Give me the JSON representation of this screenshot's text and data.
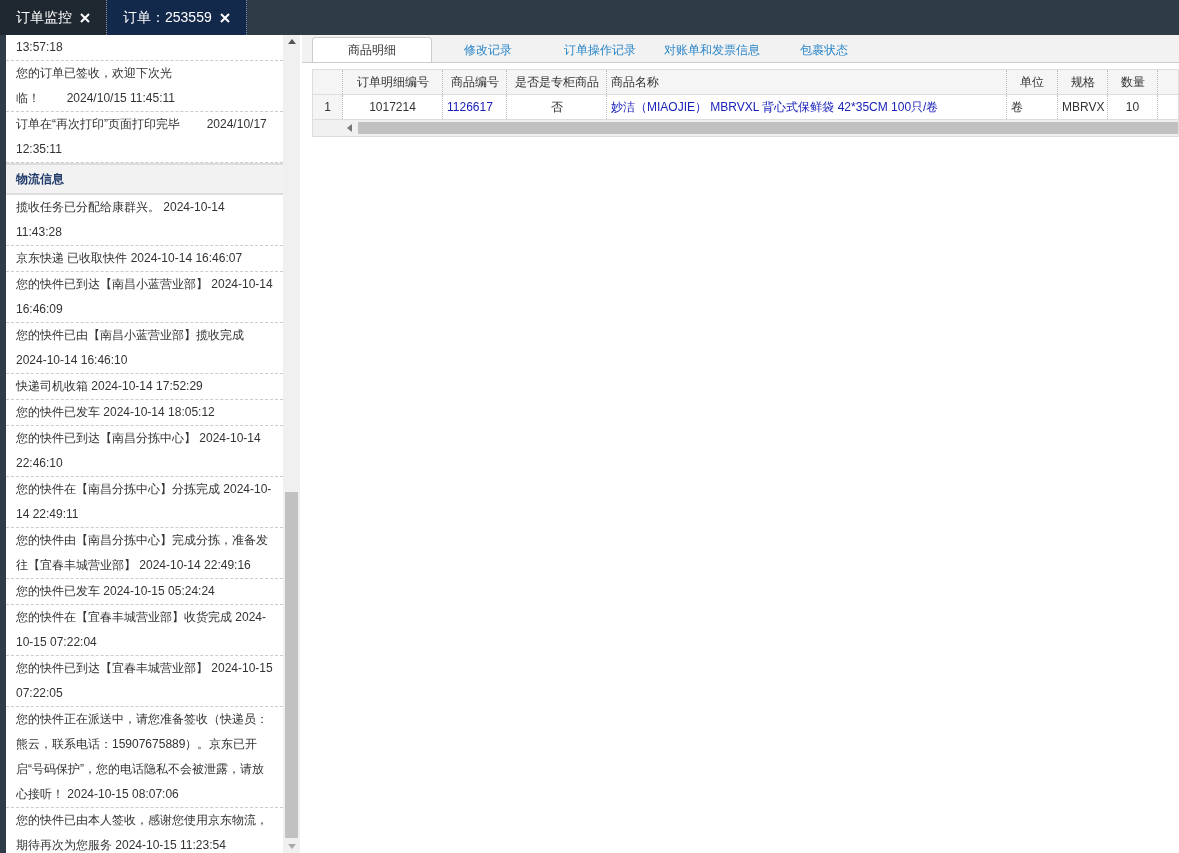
{
  "top_tabs": [
    {
      "label": "订单监控",
      "selected": false
    },
    {
      "label": "订单：253559",
      "selected": true
    }
  ],
  "order_log": [
    {
      "time": "13:57:18"
    },
    {
      "text": "您的订单已签收，欢迎下次光临！",
      "time": "2024/10/15 11:45:11"
    },
    {
      "text": "订单在“再次打印”页面打印完毕",
      "time": "2024/10/17 12:35:11"
    }
  ],
  "logistics": {
    "title": "物流信息",
    "entries": [
      "揽收任务已分配给康群兴。 2024-10-14 11:43:28",
      "京东快递 已收取快件 2024-10-14 16:46:07",
      "您的快件已到达【南昌小蓝营业部】 2024-10-14 16:46:09",
      "您的快件已由【南昌小蓝营业部】揽收完成 2024-10-14 16:46:10",
      "快递司机收箱 2024-10-14 17:52:29",
      "您的快件已发车 2024-10-14 18:05:12",
      "您的快件已到达【南昌分拣中心】 2024-10-14 22:46:10",
      "您的快件在【南昌分拣中心】分拣完成 2024-10-14 22:49:11",
      "您的快件由【南昌分拣中心】完成分拣，准备发往【宜春丰城营业部】 2024-10-14 22:49:16",
      "您的快件已发车 2024-10-15 05:24:24",
      "您的快件在【宜春丰城营业部】收货完成 2024-10-15 07:22:04",
      "您的快件已到达【宜春丰城营业部】 2024-10-15 07:22:05",
      "您的快件正在派送中，请您准备签收（快递员：熊云，联系电话：15907675889）。京东已开启“号码保护”，您的电话隐私不会被泄露，请放心接听！ 2024-10-15 08:07:06",
      "您的快件已由本人签收，感谢您使用京东物流，期待再次为您服务 2024-10-15 11:23:54"
    ]
  },
  "detail_tabs": [
    {
      "label": "商品明细",
      "selected": true
    },
    {
      "label": "修改记录",
      "selected": false
    },
    {
      "label": "订单操作记录",
      "selected": false
    },
    {
      "label": "对账单和发票信息",
      "selected": false
    },
    {
      "label": "包裹状态",
      "selected": false
    }
  ],
  "table": {
    "columns": [
      "订单明细编号",
      "商品编号",
      "是否是专柜商品",
      "商品名称",
      "单位",
      "规格",
      "数量"
    ],
    "rows": [
      {
        "index": "1",
        "cells": [
          {
            "text": "1017214",
            "kind": "plain"
          },
          {
            "text": "1126617",
            "kind": "link"
          },
          {
            "text": "否",
            "kind": "plain"
          },
          {
            "text": "妙洁（MIAOJIE） MBRVXL 背心式保鲜袋 42*35CM 100只/卷",
            "kind": "link"
          },
          {
            "text": "卷",
            "kind": "plain"
          },
          {
            "text": "MBRVX",
            "kind": "plain"
          },
          {
            "text": "10",
            "kind": "plain"
          }
        ]
      }
    ]
  }
}
